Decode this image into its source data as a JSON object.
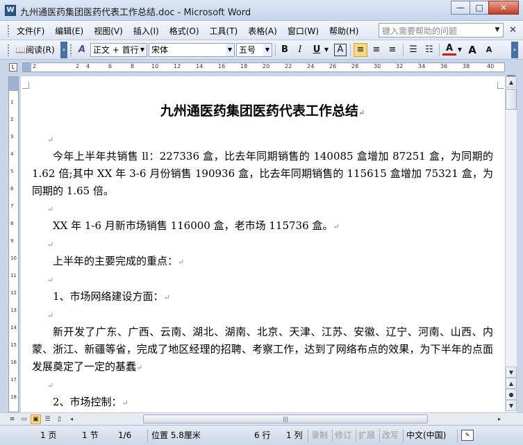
{
  "window": {
    "title": "九州通医药集团医药代表工作总结.doc - Microsoft Word",
    "icon_label": "W",
    "minimize": "—",
    "maximize": "□",
    "close": "✕"
  },
  "menu": {
    "items": [
      "文件(F)",
      "编辑(E)",
      "视图(V)",
      "插入(I)",
      "格式(O)",
      "工具(T)",
      "表格(A)",
      "窗口(W)",
      "帮助(H)"
    ],
    "help_placeholder": "键入需要帮助的问题",
    "help_dropdown": "▼",
    "close_doc": "✕"
  },
  "toolbar": {
    "reading_label": "阅读(R)",
    "style_value": "正文 + 首行",
    "font_value": "宋体",
    "size_value": "五号",
    "bold": "B",
    "italic": "I",
    "underline": "U",
    "char_border": "A",
    "align_left": "≡",
    "align_center": "≡",
    "align_right": "≡",
    "numbering": "☰",
    "bullets": "☷",
    "font_color": "A",
    "grow_font": "A",
    "shrink_font": "A",
    "active_align": "align_left"
  },
  "ruler": {
    "numbers": [
      "2",
      "2",
      "4",
      "6",
      "8",
      "10",
      "12",
      "14",
      "16",
      "18",
      "20",
      "22",
      "24",
      "26",
      "28",
      "30",
      "32",
      "34",
      "36",
      "38",
      "40"
    ],
    "vnumbers": [
      "1",
      "2",
      "3",
      "4",
      "5",
      "6",
      "7",
      "8",
      "9",
      "10",
      "11",
      "12",
      "13",
      "14",
      "15",
      "16",
      "17",
      "18",
      "19"
    ]
  },
  "document": {
    "title": "九州通医药集团医药代表工作总结",
    "paragraph_mark": "↵",
    "p1": "今年上半年共销售 ll：227336 盒，比去年同期销售的 140085 盒增加 87251 盒，为同期的 1.62 倍;其中 XX 年 3-6 月份销售 190936 盒，比去年同期销售的 115615 盒增加 75321 盒，为同期的 1.65 倍。",
    "p2": "XX 年 1-6 月新市场销售 116000 盒，老市场 115736 盒。",
    "p3": "上半年的主要完成的重点：",
    "p4": "1、市场网络建设方面：",
    "p5": "新开发了广东、广西、云南、湖北、湖南、北京、天津、江苏、安徽、辽宁、河南、山西、内蒙、浙江、新疆等省，完成了地区经理的招聘、考察工作，达到了网络布点的效果，为下半年的点面发展奠定了一定的基蠢",
    "p6": "2、市场控制："
  },
  "scrollbar": {
    "up": "▲",
    "down": "▼",
    "prev_page": "▲",
    "select_browse": "●",
    "next_page": "▼",
    "left": "◂",
    "right": "▸",
    "thumb_grip": "|||"
  },
  "status": {
    "page": "1 页",
    "section": "1 节",
    "page_of": "1/6",
    "position": "位置 5.8厘米",
    "line": "6 行",
    "column": "1 列",
    "rec": "录制",
    "trk": "修订",
    "ext": "扩展",
    "ovr": "改写",
    "language": "中文(中国)"
  }
}
